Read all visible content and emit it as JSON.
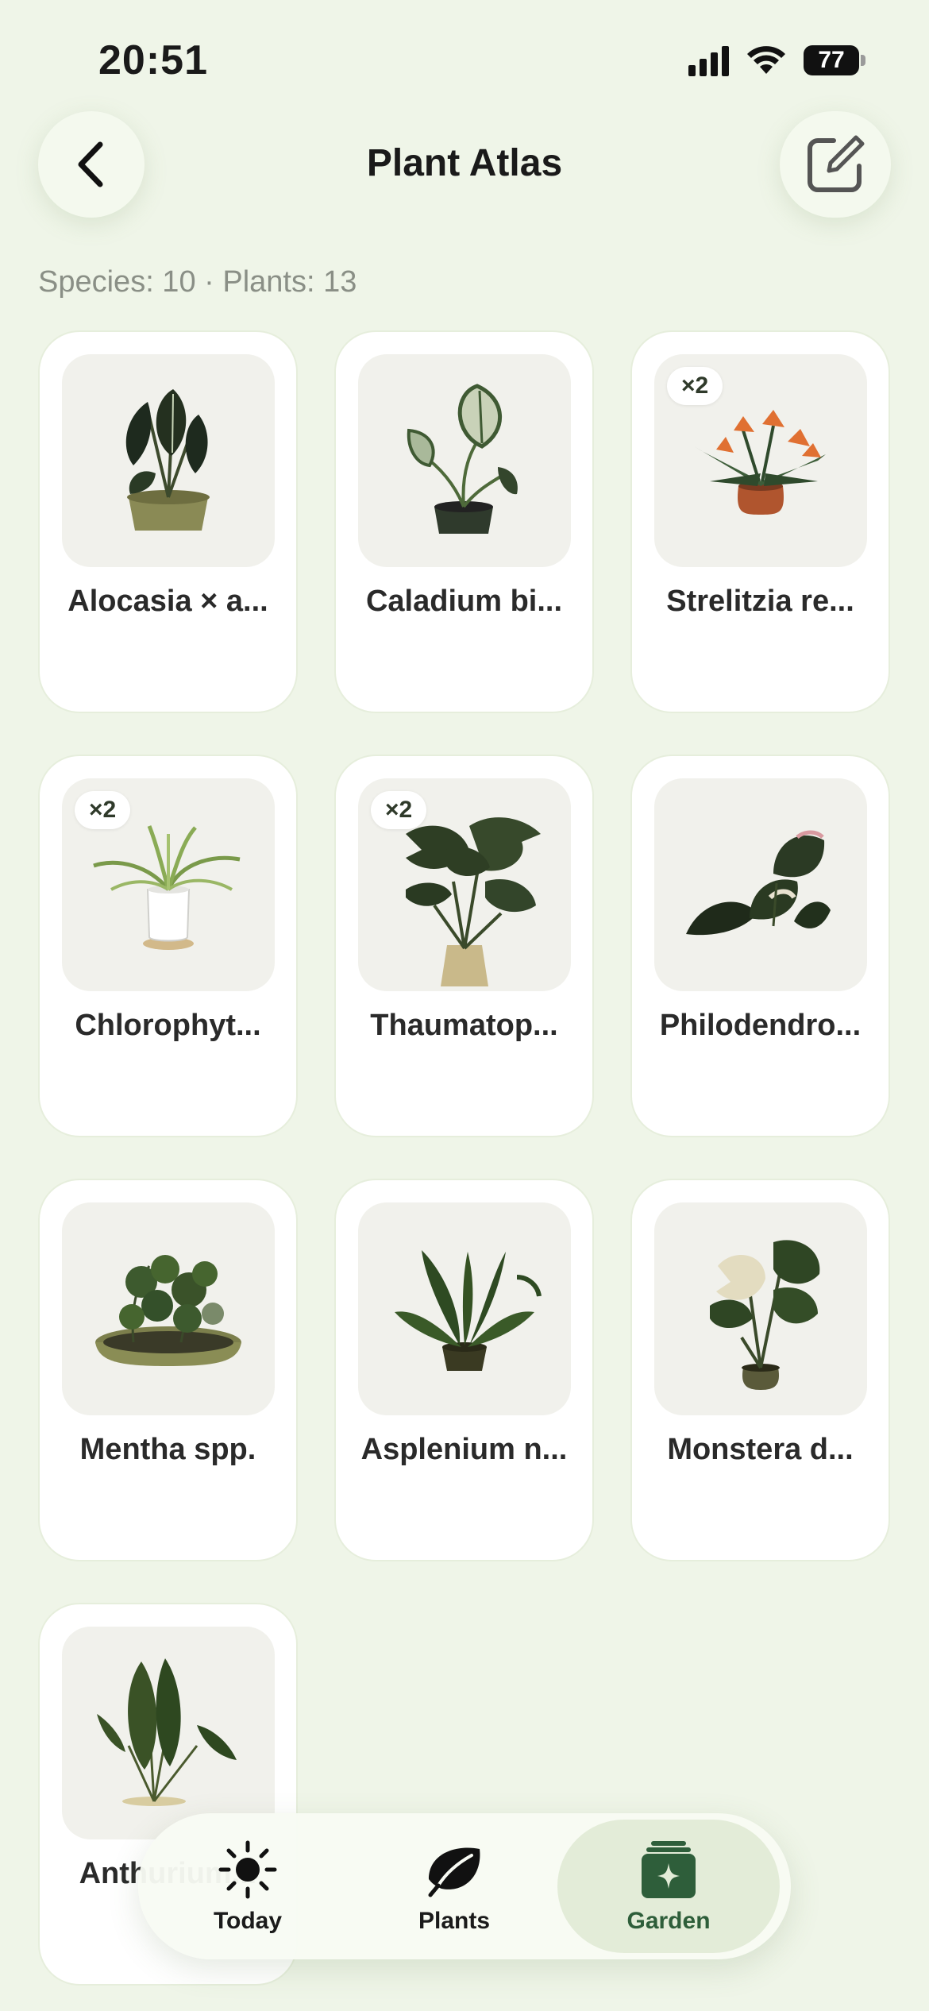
{
  "status_bar": {
    "time": "20:51",
    "battery": "77"
  },
  "header": {
    "title": "Plant Atlas"
  },
  "summary": "Species: 10 · Plants: 13",
  "plants": [
    {
      "name": "Alocasia × a...",
      "count": ""
    },
    {
      "name": "Caladium bi...",
      "count": ""
    },
    {
      "name": "Strelitzia re...",
      "count": "×2"
    },
    {
      "name": "Chlorophyt...",
      "count": "×2"
    },
    {
      "name": "Thaumatop...",
      "count": "×2"
    },
    {
      "name": "Philodendro...",
      "count": ""
    },
    {
      "name": "Mentha spp.",
      "count": ""
    },
    {
      "name": "Asplenium n...",
      "count": ""
    },
    {
      "name": "Monstera d...",
      "count": ""
    },
    {
      "name": "Anthurium...",
      "count": ""
    }
  ],
  "tabs": [
    {
      "label": "Today",
      "icon": "sun-icon"
    },
    {
      "label": "Plants",
      "icon": "leaf-icon"
    },
    {
      "label": "Garden",
      "icon": "garden-stack-icon",
      "selected": true
    }
  ],
  "colors": {
    "background": "#eff5e8",
    "accent": "#2e5e3a",
    "card": "#ffffff"
  }
}
